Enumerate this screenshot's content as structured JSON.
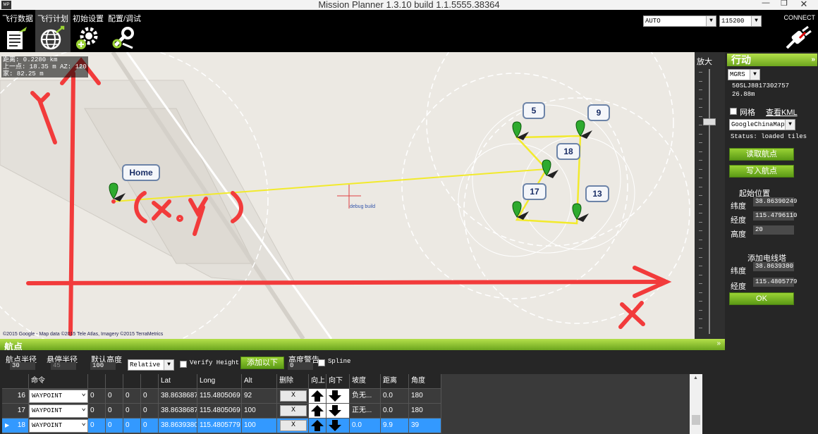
{
  "window": {
    "title": "Mission Planner 1.3.10 build 1.1.5555.38364",
    "logo_text": "MP"
  },
  "menu": [
    {
      "label": "飞行数据",
      "icon": "flight-data-icon"
    },
    {
      "label": "飞行计划",
      "icon": "flight-plan-globe-icon"
    },
    {
      "label": "初始设置",
      "icon": "initial-setup-gears-icon"
    },
    {
      "label": "配置/调试",
      "icon": "config-tuning-wrench-icon"
    }
  ],
  "connection": {
    "port": "AUTO",
    "baud": "115200",
    "connect_label": "CONNECT"
  },
  "map": {
    "info_lines": [
      "距离: 0.2280 km",
      "上一点: 18.35 m AZ: 120",
      "家: 82.25 m"
    ],
    "copyright": "©2015 Google - Map data ©2015 Tele Atlas, Imagery ©2015 TerraMetrics",
    "debug_text": "debug build",
    "home_label": "Home",
    "waypoints": [
      "5",
      "9",
      "18",
      "17",
      "13"
    ],
    "annotation": {
      "y_label": "y",
      "x_label": "x",
      "point_label": "(x,y)"
    }
  },
  "zoom": {
    "label": "放大",
    "level": 0.28
  },
  "action_panel": {
    "title": "行动",
    "coord_system": "MGRS",
    "coord_value": "50SLJ8817302757",
    "altitude": "26.88m",
    "grid_label": "网格",
    "kml_link": "查看KML",
    "map_provider": "GoogleChinaMap",
    "status": "Status: loaded tiles",
    "read_wp": "读取航点",
    "write_wp": "写入航点",
    "home_section": "起始位置",
    "lat_label": "纬度",
    "lon_label": "经度",
    "alt_label": "高度",
    "home_lat": "38.86390249",
    "home_lon": "115.4796110",
    "home_alt": "20",
    "tower_section": "添加电线塔",
    "tower_lat": "38.8639380",
    "tower_lon": "115.4805779",
    "ok": "OK"
  },
  "waypoints_panel": {
    "title": "航点",
    "wp_radius_label": "航点半径",
    "wp_radius": "30",
    "loiter_radius_label": "悬停半径",
    "loiter_radius": "45",
    "default_alt_label": "默认高度",
    "default_alt": "100",
    "alt_mode": "Relative",
    "verify_height": "Verify Height",
    "add_below": "添加以下",
    "alt_warn_label": "高度警告",
    "alt_warn": "0",
    "spline": "Spline",
    "columns": [
      "",
      "命令",
      "",
      "",
      "",
      "",
      "Lat",
      "Long",
      "Alt",
      "删除",
      "向上",
      "向下",
      "坡度",
      "距离",
      "角度"
    ],
    "rows": [
      {
        "num": "16",
        "cmd": "WAYPOINT",
        "p1": "0",
        "p2": "0",
        "p3": "0",
        "p4": "0",
        "lat": "38.8638687",
        "lon": "115.4805069",
        "alt": "92",
        "del": "X",
        "grad": "负无...",
        "dist": "0.0",
        "angle": "180"
      },
      {
        "num": "17",
        "cmd": "WAYPOINT",
        "p1": "0",
        "p2": "0",
        "p3": "0",
        "p4": "0",
        "lat": "38.8638687",
        "lon": "115.4805069",
        "alt": "100",
        "del": "X",
        "grad": "正无...",
        "dist": "0.0",
        "angle": "180"
      },
      {
        "num": "18",
        "cmd": "WAYPOINT",
        "p1": "0",
        "p2": "0",
        "p3": "0",
        "p4": "0",
        "lat": "38.8639380",
        "lon": "115.4805779",
        "alt": "100",
        "del": "X",
        "grad": "0.0",
        "dist": "9.9",
        "angle": "39"
      }
    ]
  }
}
